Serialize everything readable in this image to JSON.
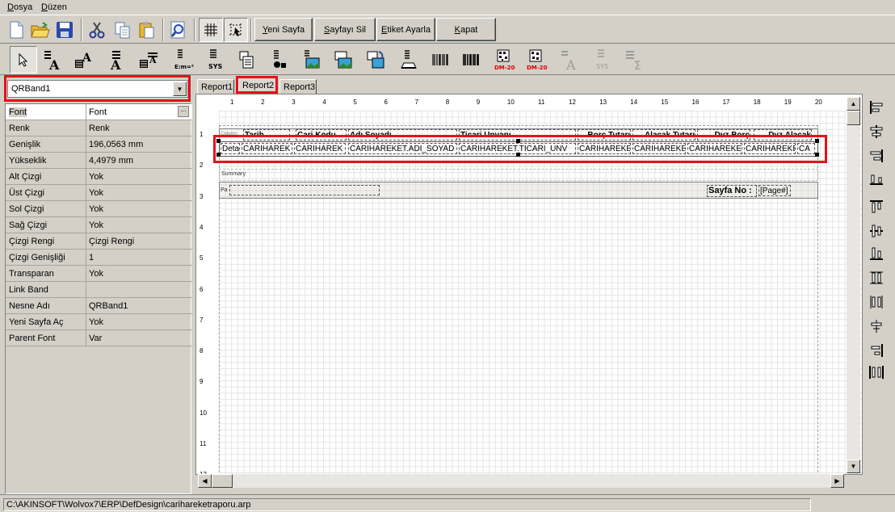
{
  "menu": {
    "file": "Dosya",
    "edit": "Düzen"
  },
  "toolbar": {
    "new_page": "Yeni Sayfa",
    "delete_page": "Sayfayı Sil",
    "label_settings": "Etiket Ayarla",
    "close": "Kapat"
  },
  "toolbar2": {
    "expr_text": "E:m=²",
    "sys_text": "SYS",
    "dm200_a": "DM-200",
    "dm200_b": "DM-200",
    "sys_text2": "SYS"
  },
  "band_selector": {
    "value": "QRBand1"
  },
  "properties": [
    {
      "name": "Font",
      "value": "Font"
    },
    {
      "name": "Renk",
      "value": "Renk"
    },
    {
      "name": "Genişlik",
      "value": "196,0563 mm"
    },
    {
      "name": "Yükseklik",
      "value": "4,4979 mm"
    },
    {
      "name": "Alt Çizgi",
      "value": "Yok"
    },
    {
      "name": "Üst Çizgi",
      "value": "Yok"
    },
    {
      "name": "Sol Çizgi",
      "value": "Yok"
    },
    {
      "name": "Sağ Çizgi",
      "value": "Yok"
    },
    {
      "name": "Çizgi Rengi",
      "value": "Çizgi Rengi"
    },
    {
      "name": "Çizgi Genişliği",
      "value": "1"
    },
    {
      "name": "Transparan",
      "value": "Yok"
    },
    {
      "name": "Link Band",
      "value": ""
    },
    {
      "name": "Nesne Adı",
      "value": "QRBand1"
    },
    {
      "name": "Yeni Sayfa Aç",
      "value": "Yok"
    },
    {
      "name": "Parent Font",
      "value": "Var"
    }
  ],
  "tabs": [
    "Report1",
    "Report2",
    "Report3"
  ],
  "ruler": {
    "top": [
      "1",
      "2",
      "3",
      "4",
      "5",
      "6",
      "7",
      "8",
      "9",
      "10",
      "11",
      "12",
      "13",
      "14",
      "15",
      "16",
      "17",
      "18",
      "19",
      "20"
    ],
    "left": [
      "1",
      "2",
      "3",
      "4",
      "5",
      "6",
      "7",
      "8",
      "9",
      "10",
      "11",
      "12"
    ]
  },
  "report": {
    "column_band_label": "Column",
    "headers": [
      "Tarih",
      "Cari Kodu",
      "Adı Soyadı",
      "Ticari Unvanı",
      "Borç Tutarı",
      "Alacak Tutarı",
      "Dvz.Borç",
      "Dvz.Alacak"
    ],
    "detail_label": "Deta",
    "fields": [
      "CARIHAREK",
      "CARIHAREK",
      "CARIHAREKET.ADI_SOYAD",
      "CARIHAREKET.TICARI_UNV",
      "CARIHAREKE",
      "CARIHAREKE",
      "CARIHAREKE",
      "CARIHAREKE",
      "CA"
    ],
    "summary_label": "Summary",
    "page_footer_label": "Pa",
    "page_no_label": "Sayfa No :",
    "page_no_field": "[Page#]"
  },
  "status": {
    "path": "C:\\AKINSOFT\\Wolvox7\\ERP\\DefDesign\\carihareketraporu.arp"
  },
  "colors": {
    "highlight": "#e8101a",
    "background": "#d4d0c8"
  }
}
